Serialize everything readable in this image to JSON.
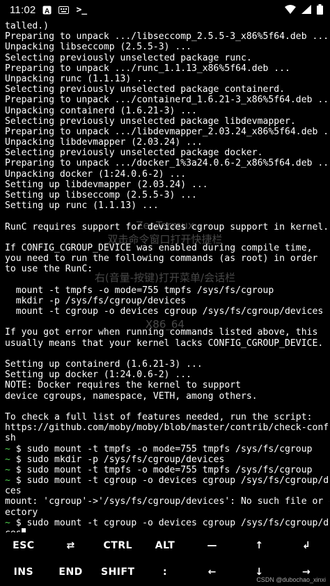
{
  "status_bar": {
    "time": "11:02",
    "icons": [
      "font-app-icon",
      "keyboard-icon",
      "terminal-prompt-icon",
      "wifi-icon",
      "signal-icon",
      "battery-icon"
    ],
    "prompt_glyph": ">_"
  },
  "terminal": {
    "lines": [
      {
        "text": "talled.)"
      },
      {
        "text": "Preparing to unpack .../libseccomp_2.5.5-3_x86%5f64.deb ..."
      },
      {
        "text": "Unpacking libseccomp (2.5.5-3) ..."
      },
      {
        "text": "Selecting previously unselected package runc."
      },
      {
        "text": "Preparing to unpack .../runc_1.1.13_x86%5f64.deb ..."
      },
      {
        "text": "Unpacking runc (1.1.13) ..."
      },
      {
        "text": "Selecting previously unselected package containerd."
      },
      {
        "text": "Preparing to unpack .../containerd_1.6.21-3_x86%5f64.deb ..."
      },
      {
        "text": "Unpacking containerd (1.6.21-3) ..."
      },
      {
        "text": "Selecting previously unselected package libdevmapper."
      },
      {
        "text": "Preparing to unpack .../libdevmapper_2.03.24_x86%5f64.deb ..."
      },
      {
        "text": "Unpacking libdevmapper (2.03.24) ..."
      },
      {
        "text": "Selecting previously unselected package docker."
      },
      {
        "text": "Preparing to unpack .../docker_1%3a24.0.6-2_x86%5f64.deb ..."
      },
      {
        "text": "Unpacking docker (1:24.0.6-2) ..."
      },
      {
        "text": "Setting up libdevmapper (2.03.24) ..."
      },
      {
        "text": "Setting up libseccomp (2.5.5-3) ..."
      },
      {
        "text": "Setting up runc (1.1.13) ..."
      },
      {
        "text": ""
      },
      {
        "text": "RunC requires support for devices cgroup support in kernel."
      },
      {
        "text": ""
      },
      {
        "text": "If CONFIG_CGROUP_DEVICE was enabled during compile time,"
      },
      {
        "text": "you need to run the following commands (as root) in order"
      },
      {
        "text": "to use the RunC:"
      },
      {
        "text": ""
      },
      {
        "text": "  mount -t tmpfs -o mode=755 tmpfs /sys/fs/cgroup"
      },
      {
        "text": "  mkdir -p /sys/fs/cgroup/devices"
      },
      {
        "text": "  mount -t cgroup -o devices cgroup /sys/fs/cgroup/devices"
      },
      {
        "text": ""
      },
      {
        "text": "If you got error when running commands listed above, this"
      },
      {
        "text": "usually means that your kernel lacks CONFIG_CGROUP_DEVICE."
      },
      {
        "text": ""
      },
      {
        "text": "Setting up containerd (1.6.21-3) ..."
      },
      {
        "text": "Setting up docker (1:24.0.6-2) ..."
      },
      {
        "text": "NOTE: Docker requires the kernel to support"
      },
      {
        "text": "device cgroups, namespace, VETH, among others."
      },
      {
        "text": ""
      },
      {
        "text": "To check a full list of features needed, run the script:"
      },
      {
        "text": "https://github.com/moby/moby/blob/master/contrib/check-config."
      },
      {
        "text": "sh"
      },
      {
        "prompt": "~",
        "text": " $ sudo mount -t tmpfs -o mode=755 tmpfs /sys/fs/cgroup"
      },
      {
        "prompt": "~",
        "text": " $ sudo mkdir -p /sys/fs/cgroup/devices"
      },
      {
        "prompt": "~",
        "text": " $ sudo mount -t tmpfs -o mode=755 tmpfs /sys/fs/cgroup"
      },
      {
        "prompt": "~",
        "text": " $ sudo mount -t cgroup -o devices cgroup /sys/fs/cgroup/devi"
      },
      {
        "text": "ces"
      },
      {
        "text": "mount: 'cgroup'->'/sys/fs/cgroup/devices': No such file or dir"
      },
      {
        "text": "ectory"
      },
      {
        "prompt": "~",
        "text": " $ sudo mount -t cgroup -o devices cgroup /sys/fs/cgroup/devi"
      },
      {
        "text": "ces",
        "cursor": true
      }
    ]
  },
  "watermark": {
    "lines": [
      "Zer-Termux",
      "双击命令窗口打开快捷栏",
      "右(音量-按键)打开菜单/会话栏",
      "X86_64"
    ]
  },
  "extra_keys": {
    "row1": [
      "ESC",
      "⇄",
      "CTRL",
      "ALT",
      "—",
      "↑",
      "↲"
    ],
    "row2": [
      "INS",
      "END",
      "SHIFT",
      ":",
      "←",
      "↓",
      "→"
    ]
  },
  "footer": "CSDN @dubochao_xinxi",
  "colors": {
    "prompt": "#4fd04f",
    "background": "#000000",
    "text": "#ffffff"
  }
}
